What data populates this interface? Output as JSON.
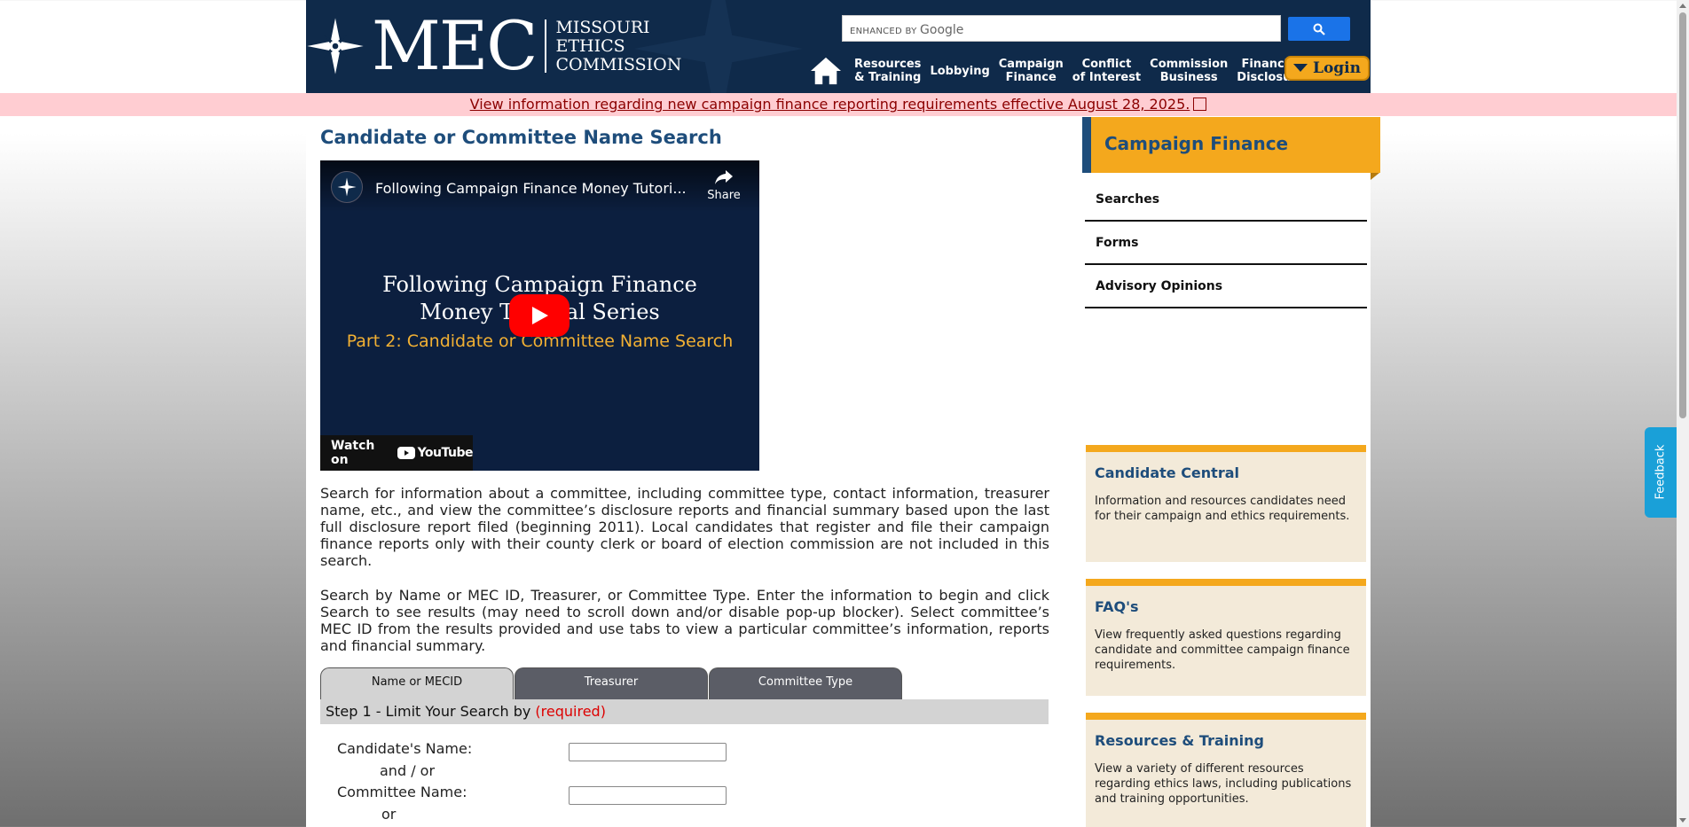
{
  "header": {
    "logo_text": "MEC",
    "logo_sub_1": "MISSOURI",
    "logo_sub_2": "ETHICS",
    "logo_sub_3": "COMMISSION",
    "search": {
      "brand_prefix": "ENHANCED BY",
      "brand_name": "Google",
      "placeholder": ""
    },
    "nav": [
      {
        "line1": "Resources",
        "line2": "& Training"
      },
      {
        "line1": "Lobbying",
        "line2": ""
      },
      {
        "line1": "Campaign",
        "line2": "Finance"
      },
      {
        "line1": "Conflict",
        "line2": "of Interest"
      },
      {
        "line1": "Commission",
        "line2": "Business"
      },
      {
        "line1": "Financial",
        "line2": "Disclosure"
      }
    ],
    "login_label": "Login"
  },
  "alert": {
    "text": "View information regarding new campaign finance reporting requirements effective August 28, 2025."
  },
  "main": {
    "title": "Candidate or Committee Name Search",
    "video": {
      "title": "Following Campaign Finance Money Tutori...",
      "share": "Share",
      "line1": "Following Campaign Finance",
      "line2": "Money Tutorial Series",
      "line3": "Part 2: Candidate or Committee Name Search",
      "watch_on": "Watch on",
      "youtube": "YouTube"
    },
    "para1": "Search for information about a committee, including committee type, contact information, treasurer name, etc., and view the committee’s disclosure reports and financial summary based upon the last full disclosure report filed (beginning 2011). Local candidates that register and file their campaign finance reports only with their county clerk or board of election commission are not included in this search.",
    "para2": "Search by Name or MEC ID, Treasurer, or Committee Type. Enter the information to begin and click Search to see results (may need to scroll down and/or disable pop-up blocker). Select committee’s MEC ID from the results provided and use tabs to view a particular committee’s information, reports and financial summary.",
    "tabs": [
      "Name or MECID",
      "Treasurer",
      "Committee Type"
    ],
    "step_label": "Step 1 - Limit Your Search by",
    "step_required": "(required)",
    "form": {
      "candidate_label": "Candidate's Name:",
      "and_or": "and / or",
      "committee_label": "Committee Name:",
      "or": "or",
      "candidate_value": "",
      "committee_value": ""
    }
  },
  "sidebar": {
    "header": "Campaign Finance",
    "links": [
      "Searches",
      "Forms",
      "Advisory Opinions"
    ],
    "promos": [
      {
        "title": "Candidate Central",
        "text": "Information and resources candidates need for their campaign and ethics requirements."
      },
      {
        "title": "FAQ's",
        "text": "View frequently asked questions regarding candidate and committee campaign finance requirements."
      },
      {
        "title": "Resources & Training",
        "text": "View a variety of different resources regarding ethics laws, including publications and training opportunities."
      }
    ]
  },
  "feedback_label": "Feedback",
  "colors": {
    "navy": "#0f2a4a",
    "accent_orange": "#f4a81d",
    "title_blue": "#1e4d7b",
    "alert_bg": "#ffcdd2",
    "alert_text": "#8b0000",
    "promo_bg": "#f3ead9"
  },
  "icons": [
    "compass-logo-icon",
    "home-icon",
    "search-icon",
    "caret-down-icon",
    "external-link-icon",
    "share-icon",
    "play-icon",
    "youtube-icon"
  ]
}
